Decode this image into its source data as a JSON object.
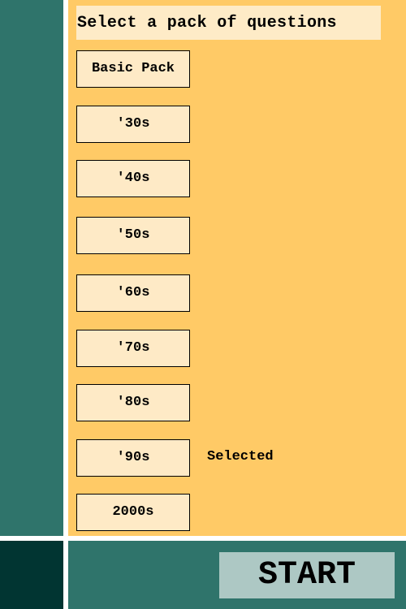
{
  "title": "Select a pack of questions",
  "packs": [
    {
      "label": "Basic Pack"
    },
    {
      "label": "'30s"
    },
    {
      "label": "'40s"
    },
    {
      "label": "'50s"
    },
    {
      "label": "'60s"
    },
    {
      "label": "'70s"
    },
    {
      "label": "'80s"
    },
    {
      "label": "'90s"
    },
    {
      "label": "2000s"
    }
  ],
  "selected_index": 7,
  "selected_label": "Selected",
  "start_label": "START",
  "colors": {
    "teal": "#2f746b",
    "dark_teal": "#013532",
    "panel_yellow": "#ffca66",
    "button_cream": "#feeac6",
    "start_button": "#adc8c4"
  }
}
